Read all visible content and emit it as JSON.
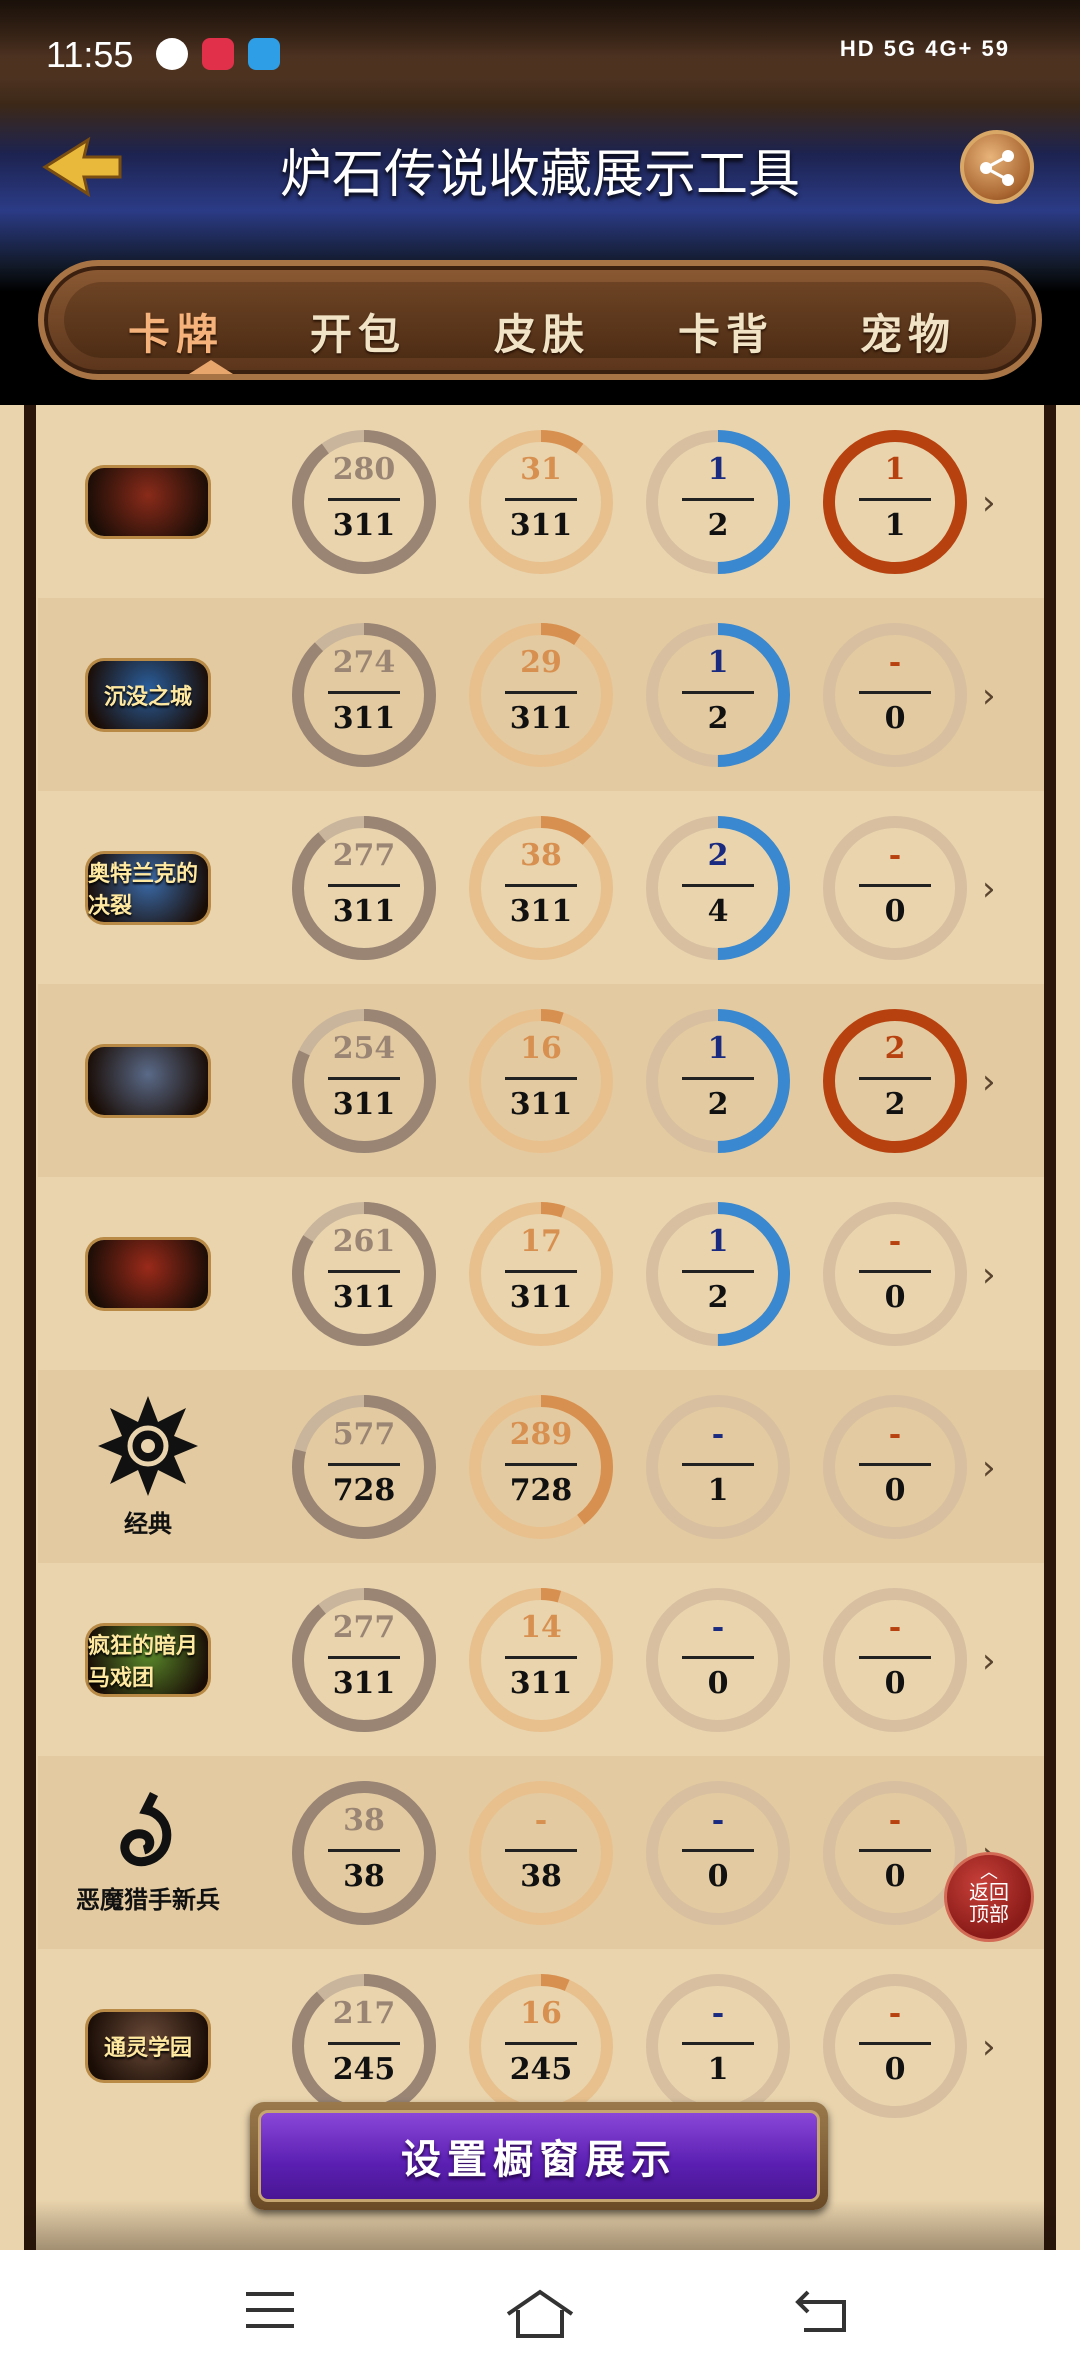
{
  "status_bar": {
    "time": "11:55",
    "right_text": "HD 5G 4G+ 59"
  },
  "header": {
    "title": "炉石传说收藏展示工具"
  },
  "tabs": [
    {
      "label": "卡牌",
      "active": true
    },
    {
      "label": "开包",
      "active": false
    },
    {
      "label": "皮肤",
      "active": false
    },
    {
      "label": "卡背",
      "active": false
    },
    {
      "label": "宠物",
      "active": false
    }
  ],
  "colors": {
    "common": "#9a8575",
    "rare": "#d89050",
    "epic": "#3a88cf",
    "legendary": "#b8420f",
    "track_common": "#c9b59c",
    "track_rare": "#e8c08e",
    "track_epic": "#d7bfa0"
  },
  "sets": [
    {
      "logo_text": "",
      "name": "",
      "color": "#8a2b1a",
      "stats": [
        {
          "owned": "280",
          "total": "311",
          "fill": 0.9
        },
        {
          "owned": "31",
          "total": "311",
          "fill": 0.1
        },
        {
          "owned": "1",
          "total": "2",
          "fill": 0.5
        },
        {
          "owned": "1",
          "total": "1",
          "fill": 1.0
        }
      ]
    },
    {
      "logo_text": "沉没之城",
      "name": "",
      "color": "#2a5e9c",
      "stats": [
        {
          "owned": "274",
          "total": "311",
          "fill": 0.88
        },
        {
          "owned": "29",
          "total": "311",
          "fill": 0.093
        },
        {
          "owned": "1",
          "total": "2",
          "fill": 0.5
        },
        {
          "owned": "-",
          "total": "0",
          "fill": 0
        }
      ]
    },
    {
      "logo_text": "奥特兰克的决裂",
      "name": "",
      "color": "#3a6aa8",
      "stats": [
        {
          "owned": "277",
          "total": "311",
          "fill": 0.89
        },
        {
          "owned": "38",
          "total": "311",
          "fill": 0.122
        },
        {
          "owned": "2",
          "total": "4",
          "fill": 0.5
        },
        {
          "owned": "-",
          "total": "0",
          "fill": 0
        }
      ]
    },
    {
      "logo_text": "",
      "name": "",
      "color": "#5a6a88",
      "stats": [
        {
          "owned": "254",
          "total": "311",
          "fill": 0.82
        },
        {
          "owned": "16",
          "total": "311",
          "fill": 0.051
        },
        {
          "owned": "1",
          "total": "2",
          "fill": 0.5
        },
        {
          "owned": "2",
          "total": "2",
          "fill": 1.0
        }
      ]
    },
    {
      "logo_text": "",
      "name": "",
      "color": "#9a2a1a",
      "stats": [
        {
          "owned": "261",
          "total": "311",
          "fill": 0.84
        },
        {
          "owned": "17",
          "total": "311",
          "fill": 0.055
        },
        {
          "owned": "1",
          "total": "2",
          "fill": 0.5
        },
        {
          "owned": "-",
          "total": "0",
          "fill": 0
        }
      ]
    },
    {
      "logo_text": "",
      "name": "经典",
      "color": "#000000",
      "stats": [
        {
          "owned": "577",
          "total": "728",
          "fill": 0.79
        },
        {
          "owned": "289",
          "total": "728",
          "fill": 0.397
        },
        {
          "owned": "-",
          "total": "1",
          "fill": 0
        },
        {
          "owned": "-",
          "total": "0",
          "fill": 0
        }
      ]
    },
    {
      "logo_text": "疯狂的暗月马戏团",
      "name": "",
      "color": "#5a8a2a",
      "stats": [
        {
          "owned": "277",
          "total": "311",
          "fill": 0.89
        },
        {
          "owned": "14",
          "total": "311",
          "fill": 0.045
        },
        {
          "owned": "-",
          "total": "0",
          "fill": 0
        },
        {
          "owned": "-",
          "total": "0",
          "fill": 0
        }
      ]
    },
    {
      "logo_text": "",
      "name": "恶魔猎手新兵",
      "color": "#000000",
      "stats": [
        {
          "owned": "38",
          "total": "38",
          "fill": 1.0
        },
        {
          "owned": "-",
          "total": "38",
          "fill": 0
        },
        {
          "owned": "-",
          "total": "0",
          "fill": 0
        },
        {
          "owned": "-",
          "total": "0",
          "fill": 0
        }
      ]
    },
    {
      "logo_text": "通灵学园",
      "name": "",
      "color": "#6a4a38",
      "stats": [
        {
          "owned": "217",
          "total": "245",
          "fill": 0.886
        },
        {
          "owned": "16",
          "total": "245",
          "fill": 0.065
        },
        {
          "owned": "-",
          "total": "1",
          "fill": 0
        },
        {
          "owned": "-",
          "total": "0",
          "fill": 0
        }
      ]
    }
  ],
  "back_to_top": {
    "line1": "返回",
    "line2": "顶部"
  },
  "showcase_button": {
    "label": "设置橱窗展示"
  }
}
